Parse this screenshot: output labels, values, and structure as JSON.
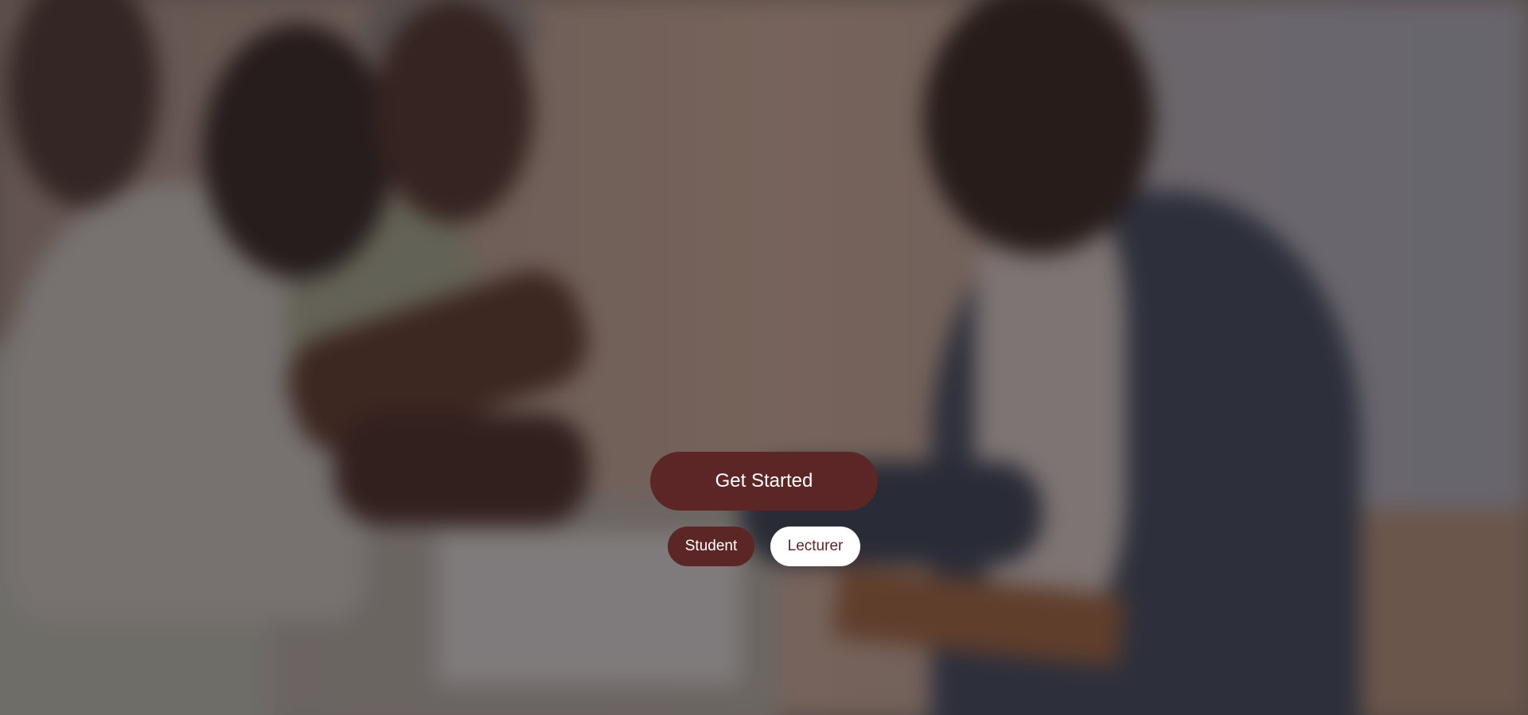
{
  "hero": {
    "background_image": "blurred-classroom-photo",
    "primary_button_label": "Get Started",
    "roles": [
      {
        "label": "Student",
        "selected": true
      },
      {
        "label": "Lecturer",
        "selected": false
      }
    ]
  },
  "colors": {
    "primary": "#5d2626",
    "on_primary": "#ffffff",
    "secondary_bg": "#ffffff"
  }
}
